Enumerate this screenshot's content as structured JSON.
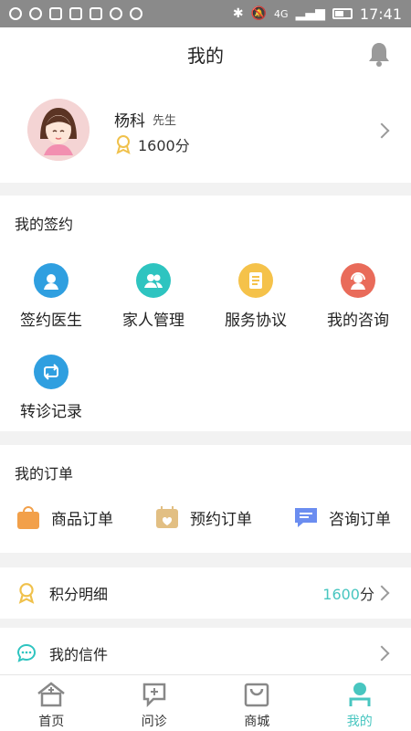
{
  "statusbar": {
    "time": "17:41",
    "network": "4G"
  },
  "header": {
    "title": "我的"
  },
  "profile": {
    "name": "杨科",
    "gender": "先生",
    "points": "1600分"
  },
  "signing": {
    "title": "我的签约",
    "items": [
      {
        "label": "签约医生",
        "icon": "doctor-icon",
        "color": "#2f9fe0"
      },
      {
        "label": "家人管理",
        "icon": "family-icon",
        "color": "#2ec4c0"
      },
      {
        "label": "服务协议",
        "icon": "agreement-icon",
        "color": "#f5c24a"
      },
      {
        "label": "我的咨询",
        "icon": "consult-icon",
        "color": "#e96b5a"
      },
      {
        "label": "转诊记录",
        "icon": "referral-icon",
        "color": "#2f9fe0"
      }
    ]
  },
  "orders": {
    "title": "我的订单",
    "items": [
      {
        "label": "商品订单",
        "icon": "shopping-bag-icon",
        "color": "#f2a04a"
      },
      {
        "label": "预约订单",
        "icon": "calendar-icon",
        "color": "#e2bf83"
      },
      {
        "label": "咨询订单",
        "icon": "chat-icon",
        "color": "#6b8df0"
      }
    ]
  },
  "rows": [
    {
      "label": "积分明细",
      "icon": "badge-icon",
      "value": "1600",
      "unit": "分"
    },
    {
      "label": "我的信件",
      "icon": "message-icon"
    }
  ],
  "tabs": [
    {
      "label": "首页",
      "icon": "home-icon",
      "active": false
    },
    {
      "label": "问诊",
      "icon": "inquiry-icon",
      "active": false
    },
    {
      "label": "商城",
      "icon": "mall-icon",
      "active": false
    },
    {
      "label": "我的",
      "icon": "profile-icon",
      "active": true
    }
  ],
  "colors": {
    "accent": "#48c6c0",
    "statusbar": "#8a8a8a"
  }
}
